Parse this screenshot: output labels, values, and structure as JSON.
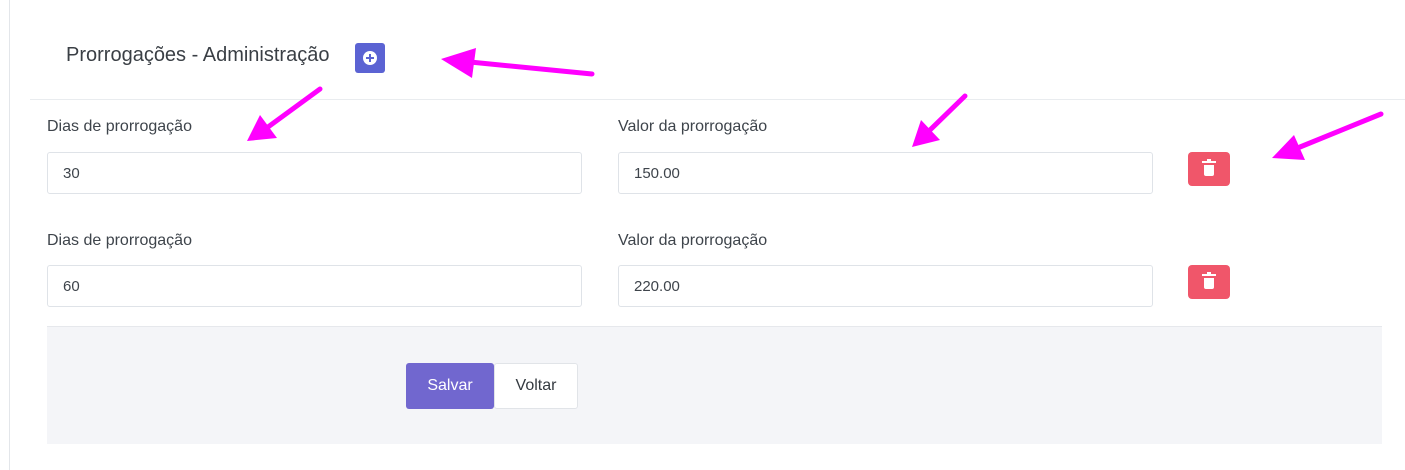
{
  "header": {
    "title": "Prorrogações - Administração",
    "add_icon": "plus-circle-icon"
  },
  "rows": [
    {
      "days_label": "Dias de prorrogação",
      "days_value": "30",
      "value_label": "Valor da prorrogação",
      "value_value": "150.00",
      "delete_icon": "trash-icon"
    },
    {
      "days_label": "Dias de prorrogação",
      "days_value": "60",
      "value_label": "Valor da prorrogação",
      "value_value": "220.00",
      "delete_icon": "trash-icon"
    }
  ],
  "footer": {
    "save_label": "Salvar",
    "back_label": "Voltar"
  },
  "colors": {
    "primary": "#5b63d3",
    "save": "#7167cf",
    "danger": "#f0566a",
    "annotation_arrow": "#ff00ff",
    "footer_bg": "#f4f5f8"
  }
}
